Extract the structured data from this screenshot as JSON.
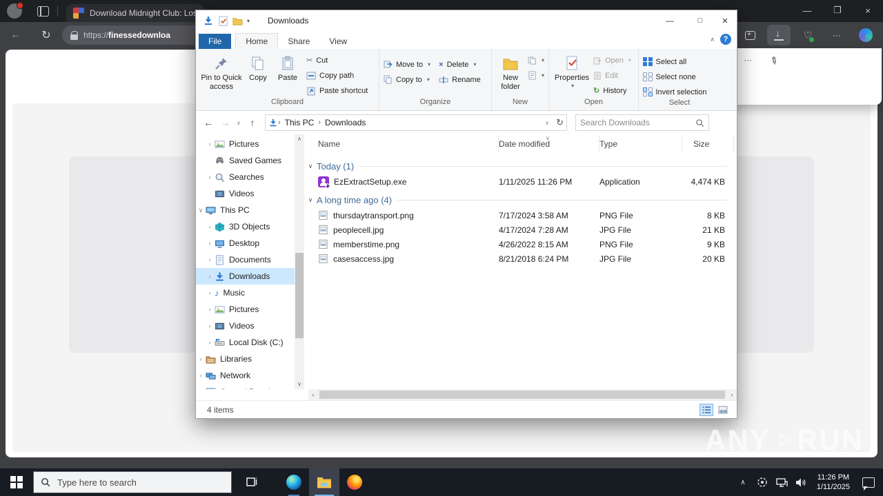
{
  "colors": {
    "accent": "#0078d7",
    "selection": "#cce8ff",
    "file_tab_blue": "#1f66ab",
    "exe_icon_purple": "#9233cf",
    "taskbar": "#171b22"
  },
  "watermark": {
    "left": "ANY",
    "right": "RUN"
  },
  "browser": {
    "tab_title": "Download Midnight Club: Los A",
    "url_scheme": "https://",
    "url_host": "finessedownloa"
  },
  "explorer": {
    "title": "Downloads",
    "tabs": [
      "File",
      "Home",
      "Share",
      "View"
    ],
    "help_label": "?",
    "ribbon": {
      "groups": [
        {
          "label": "Clipboard",
          "big": [
            "Pin to Quick access",
            "Copy",
            "Paste"
          ],
          "small": [
            "Cut",
            "Copy path",
            "Paste shortcut"
          ]
        },
        {
          "label": "Organize",
          "small": [
            "Move to",
            "Copy to",
            "Delete",
            "Rename"
          ]
        },
        {
          "label": "New",
          "big": [
            "New folder"
          ]
        },
        {
          "label": "Open",
          "big": [
            "Properties"
          ],
          "small": [
            "Open",
            "Edit",
            "History"
          ]
        },
        {
          "label": "Select",
          "small": [
            "Select all",
            "Select none",
            "Invert selection"
          ]
        }
      ]
    },
    "address": {
      "crumbs": [
        "This PC",
        "Downloads"
      ],
      "search_placeholder": "Search Downloads"
    },
    "sidebar": {
      "items": [
        {
          "label": "Pictures"
        },
        {
          "label": "Saved Games"
        },
        {
          "label": "Searches"
        },
        {
          "label": "Videos"
        },
        {
          "label": "This PC"
        },
        {
          "label": "3D Objects"
        },
        {
          "label": "Desktop"
        },
        {
          "label": "Documents"
        },
        {
          "label": "Downloads"
        },
        {
          "label": "Music"
        },
        {
          "label": "Pictures"
        },
        {
          "label": "Videos"
        },
        {
          "label": "Local Disk (C:)"
        },
        {
          "label": "Libraries"
        },
        {
          "label": "Network"
        },
        {
          "label": "Control Panel"
        }
      ]
    },
    "list": {
      "columns": [
        "Name",
        "Date modified",
        "Type",
        "Size"
      ],
      "groups": [
        {
          "label": "Today (1)",
          "files": [
            {
              "name": "EzExtractSetup.exe",
              "date": "1/11/2025 11:26 PM",
              "type": "Application",
              "size": "4,474 KB"
            }
          ]
        },
        {
          "label": "A long time ago (4)",
          "files": [
            {
              "name": "thursdaytransport.png",
              "date": "7/17/2024 3:58 AM",
              "type": "PNG File",
              "size": "8 KB"
            },
            {
              "name": "peoplecell.jpg",
              "date": "4/17/2024 7:28 AM",
              "type": "JPG File",
              "size": "21 KB"
            },
            {
              "name": "memberstime.png",
              "date": "4/26/2022 8:15 AM",
              "type": "PNG File",
              "size": "9 KB"
            },
            {
              "name": "casesaccess.jpg",
              "date": "8/21/2018 6:24 PM",
              "type": "JPG File",
              "size": "20 KB"
            }
          ]
        }
      ]
    },
    "status": {
      "items_text": "4 items"
    }
  },
  "taskbar": {
    "search_placeholder": "Type here to search",
    "clock": {
      "time": "11:26 PM",
      "date": "1/11/2025"
    }
  }
}
